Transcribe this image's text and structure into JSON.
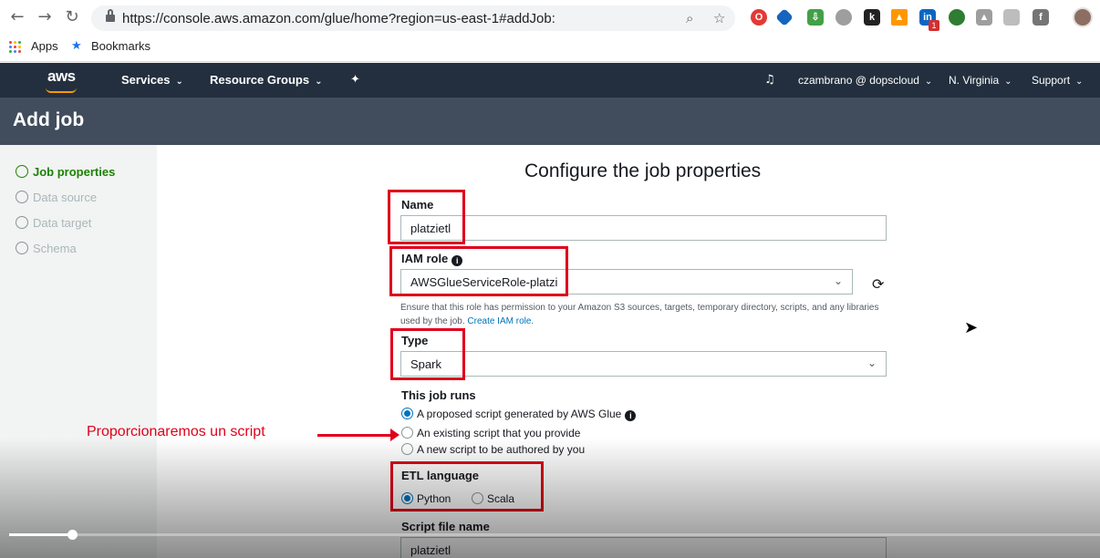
{
  "browser": {
    "url": "https://console.aws.amazon.com/glue/home?region=us-east-1#addJob:",
    "bookmarks": {
      "apps_label": "Apps",
      "bookmarks_label": "Bookmarks"
    },
    "notification_count": "1"
  },
  "aws_header": {
    "logo": "aws",
    "services": "Services",
    "resource_groups": "Resource Groups",
    "user": "czambrano @ dopscloud",
    "region": "N. Virginia",
    "support": "Support"
  },
  "page": {
    "title": "Add job"
  },
  "steps": [
    {
      "label": "Job properties",
      "active": true
    },
    {
      "label": "Data source",
      "active": false
    },
    {
      "label": "Data target",
      "active": false
    },
    {
      "label": "Schema",
      "active": false
    }
  ],
  "form": {
    "heading": "Configure the job properties",
    "name_label": "Name",
    "name_value": "platzietl",
    "iam_label": "IAM role",
    "iam_value": "AWSGlueServiceRole-platzi",
    "iam_help": "Ensure that this role has permission to your Amazon S3 sources, targets, temporary directory, scripts, and any libraries used by the job.",
    "iam_help_link": "Create IAM role.",
    "type_label": "Type",
    "type_value": "Spark",
    "runs_label": "This job runs",
    "runs_options": [
      {
        "label": "A proposed script generated by AWS Glue",
        "checked": true
      },
      {
        "label": "An existing script that you provide",
        "checked": false
      },
      {
        "label": "A new script to be authored by you",
        "checked": false
      }
    ],
    "etl_label": "ETL language",
    "etl_options": [
      {
        "label": "Python",
        "checked": true
      },
      {
        "label": "Scala",
        "checked": false
      }
    ],
    "script_label": "Script file name",
    "script_value": "platzietl"
  },
  "annotation": {
    "text": "Proporcionaremos un script",
    "color": "#e0001a"
  },
  "video": {
    "progress_fraction": 0.058
  },
  "colors": {
    "aws_nav": "#232f3e",
    "title_bar": "#414d5c",
    "active_step": "#1d8102",
    "link": "#0073bb"
  }
}
